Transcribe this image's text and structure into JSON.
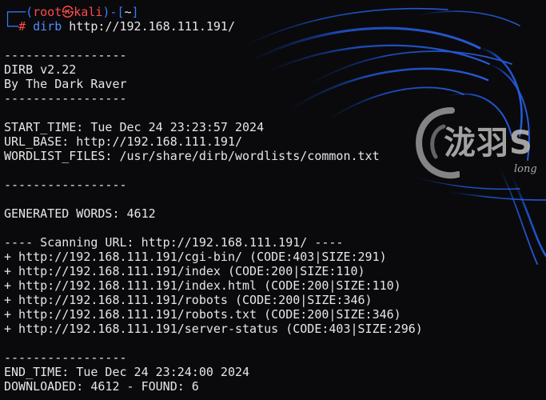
{
  "prompt": {
    "top_left": "┌──(",
    "user": "root",
    "at_symbol": "㉿",
    "host": "kali",
    "sep": ")-[",
    "path": "~",
    "close": "]",
    "bottom_left": "└─",
    "hash": "#"
  },
  "command": {
    "name": "dirb",
    "arg": "http://192.168.111.191/"
  },
  "output": {
    "sep1": "-----------------",
    "title": "DIRB v2.22",
    "author": "By The Dark Raver",
    "sep2": "-----------------",
    "start_time": "START_TIME: Tue Dec 24 23:23:57 2024",
    "url_base": "URL_BASE: http://192.168.111.191/",
    "wordlist": "WORDLIST_FILES: /usr/share/dirb/wordlists/common.txt",
    "sep3": "-----------------",
    "generated": "GENERATED WORDS: 4612",
    "scanning": "---- Scanning URL: http://192.168.111.191/ ----",
    "results": [
      "+ http://192.168.111.191/cgi-bin/ (CODE:403|SIZE:291)",
      "+ http://192.168.111.191/index (CODE:200|SIZE:110)",
      "+ http://192.168.111.191/index.html (CODE:200|SIZE:110)",
      "+ http://192.168.111.191/robots (CODE:200|SIZE:346)",
      "+ http://192.168.111.191/robots.txt (CODE:200|SIZE:346)",
      "+ http://192.168.111.191/server-status (CODE:403|SIZE:296)"
    ],
    "sep4": "-----------------",
    "end_time": "END_TIME: Tue Dec 24 23:24:00 2024",
    "downloaded": "DOWNLOADED: 4612 - FOUND: 6"
  },
  "watermark": {
    "text": "泷羽S",
    "sub": "long"
  },
  "colors": {
    "background": "#0a0a0c",
    "text": "#e6e6e6",
    "prompt_blue": "#3b7bff",
    "prompt_red": "#ff4a4a",
    "dragon_blue": "#1f55d6"
  }
}
